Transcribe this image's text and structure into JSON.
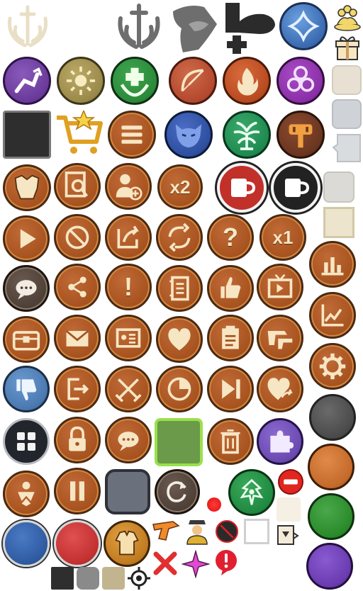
{
  "sheet": {
    "title": "",
    "background": "#ffffff"
  },
  "colors": {
    "bronze": "#a6521f",
    "bronze_edge": "#4a2a14",
    "cream": "#f6e6c4",
    "purple": "#6a3a9a",
    "olive": "#9a8a4a",
    "green": "#2a8a3a",
    "red": "#c2302a",
    "blue": "#3a6ab0",
    "teal": "#2a9a6a",
    "grey": "#555555"
  },
  "labels": {
    "x2": "x2",
    "x1": "x1",
    "question": "?",
    "exclaim": "!"
  },
  "icons": [
    "sword-laurel-emblem-icon",
    "sword-laurel-grey-icon",
    "hooded-head-icon",
    "add-person-icon",
    "star-shield-icon",
    "people-group-icon",
    "gift-box-icon",
    "robot-arm-icon",
    "sun-badge-icon",
    "heal-cross-icon",
    "bow-arrow-icon",
    "fire-icon",
    "biohazard-icon",
    "dark-square-icon",
    "cart-star-icon",
    "menu-icon",
    "demon-mask-icon",
    "tree-icon",
    "hammer-icon",
    "armor-icon",
    "search-document-icon",
    "add-user-icon",
    "x2-speed-icon",
    "red-cup-icon",
    "white-cup-icon",
    "play-icon",
    "forbidden-icon",
    "export-icon",
    "refresh-icon",
    "help-icon",
    "x1-speed-icon",
    "bar-chart-icon",
    "chat-grey-icon",
    "share-icon",
    "alert-icon",
    "notes-icon",
    "thumbs-up-icon",
    "video-icon",
    "line-chart-icon",
    "chest-icon",
    "mail-icon",
    "id-card-icon",
    "heart-icon",
    "clipboard-icon",
    "guns-icon",
    "settings-icon",
    "thumbs-down-icon",
    "logout-icon",
    "cross-swords-icon",
    "pie-icon",
    "skip-icon",
    "heart-share-icon",
    "grey-circle-icon",
    "grid-menu-icon",
    "lock-icon",
    "chat-icon",
    "green-frame-icon",
    "trash-icon",
    "puzzle-icon",
    "orange-circle-icon",
    "ranks-icon",
    "pause-icon",
    "slate-square-icon",
    "restart-icon",
    "red-dot-icon",
    "tree-badge-icon",
    "no-entry-icon",
    "green-circle-icon",
    "blue-circle-icon",
    "red-circle-icon",
    "jacket-icon",
    "blaster-icon",
    "officer-icon",
    "no-ads-icon",
    "checkbox-empty-icon",
    "drop-down-icon",
    "purple-circle-icon",
    "close-x-icon",
    "sparkle-star-icon",
    "alert-balloon-icon",
    "crosshair-icon"
  ]
}
